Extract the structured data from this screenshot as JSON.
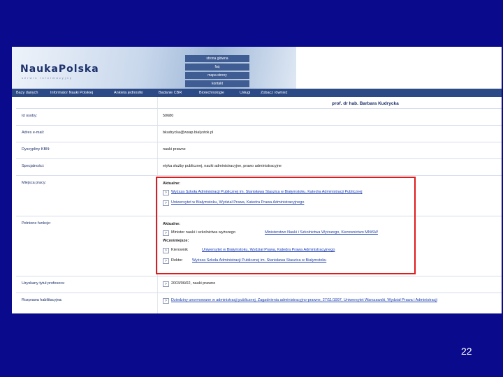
{
  "banner": {
    "logo": "NaukaPolska",
    "logo_sub": "serwis informacyjny",
    "quick_links": [
      "strona główna",
      "faq",
      "mapa strony",
      "kontakt"
    ]
  },
  "nav": [
    "Bazy danych",
    "Informator Nauki Polskiej",
    "Ankieta jednostki",
    "Badanie CBR",
    "Biotechnologie",
    "Usługi",
    "Zobacz również"
  ],
  "person": "prof. dr hab. Barbara Kudrycka",
  "fields": {
    "id_label": "Id osoby:",
    "id_value": "50680",
    "email_label": "Adres e-mail:",
    "email_value": "bkudrycka@wsap.bialystok.pl",
    "discipline_label": "Dyscypliny KBN:",
    "discipline_value": "nauki prawne",
    "specialty_label": "Specjalności:",
    "specialty_value": "etyka służby publicznej, nauki administracyjne, prawo administracyjne",
    "workplace_label": "Miejsca pracy:",
    "workplace_current": "Aktualne:",
    "workplace_links": [
      "Wyższa Szkoła Administracji Publicznej im. Stanisława Staszica w Białymstoku, Katedra Administracji Publicznej",
      "Uniwersytet w Białymstoku, Wydział Prawa, Katedra Prawa Administracyjnego"
    ],
    "functions_label": "Pełnione funkcje:",
    "functions_current": "Aktualne:",
    "functions_current_role": "Minister nauki i szkolnictwa wyższego",
    "functions_current_link": "Ministerstwo Nauki i Szkolnictwa Wyższego, Kierownictwo MNiSW",
    "functions_past": "Wcześniejsze:",
    "functions_past_items": [
      {
        "role": "Kierownik",
        "link": "Uniwersytet w Białymstoku, Wydział Prawa, Katedra Prawa Administracyjnego"
      },
      {
        "role": "Rektor",
        "link": "Wyższa Szkoła Administracji Publicznej im. Stanisława Staszica w Białymstoku"
      }
    ],
    "professor_label": "Uzyskany tytuł profesora:",
    "professor_value": "2003/06/02, nauki prawne",
    "habilitation_label": "Rozprawa habilitacyjna:",
    "habilitation_value": "Dziedziny unormowane w administracji publicznej. Zagadnienia administracyjno-prawne, 27/11/1997, Uniwersytet Warszawski, Wydział Prawa i Administracji"
  },
  "slide_number": "22"
}
